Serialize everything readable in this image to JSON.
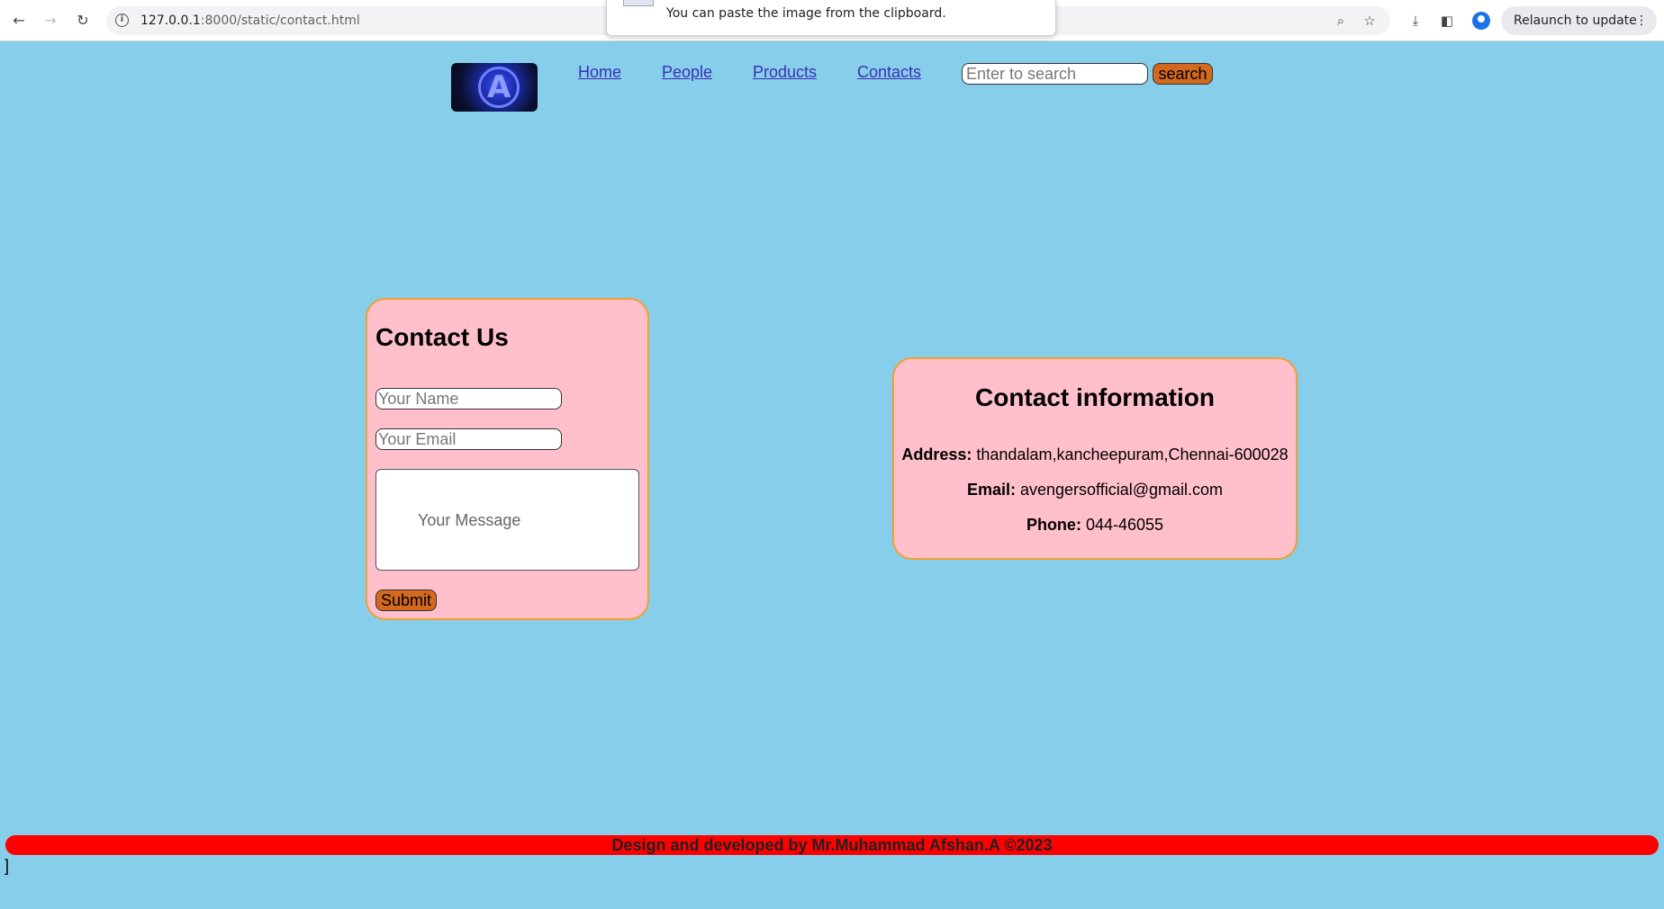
{
  "browser": {
    "url_host": "127.0.0.1",
    "url_rest": ":8000/static/contact.html",
    "clipboard_message": "You can paste the image from the clipboard.",
    "relaunch_label": "Relaunch to update"
  },
  "header": {
    "logo_icon": "avengers-logo",
    "nav": [
      "Home",
      "People",
      "Products",
      "Contacts"
    ],
    "search_placeholder": "Enter to search",
    "search_button": "search"
  },
  "contact_form": {
    "title": "Contact Us",
    "name_placeholder": "Your Name",
    "email_placeholder": "Your Email",
    "message_placeholder": "Your Message",
    "submit_label": "Submit"
  },
  "contact_info": {
    "title": "Contact information",
    "address_label": "Address:",
    "address_value": "thandalam,kancheepuram,Chennai-600028",
    "email_label": "Email:",
    "email_value": "avengersofficial@gmail.com",
    "phone_label": "Phone:",
    "phone_value": "044-46055"
  },
  "footer": {
    "text": "Design and developed by Mr.Muhammad Afshan.A ©2023",
    "stray_char": "]"
  },
  "colors": {
    "page_bg": "#87ceeb",
    "card_bg": "#ffc0cb",
    "card_border": "#f0a030",
    "button_bg": "#d2691e",
    "footer_bg": "#ff0000",
    "link": "#3b2fb6"
  }
}
